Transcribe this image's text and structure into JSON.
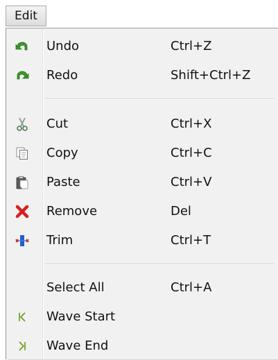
{
  "menubar": {
    "title": "Edit"
  },
  "menu": {
    "items": [
      {
        "label": "Undo",
        "shortcut": "Ctrl+Z",
        "icon": "undo-icon"
      },
      {
        "label": "Redo",
        "shortcut": "Shift+Ctrl+Z",
        "icon": "redo-icon"
      },
      {
        "label": "Cut",
        "shortcut": "Ctrl+X",
        "icon": "scissors-icon"
      },
      {
        "label": "Copy",
        "shortcut": "Ctrl+C",
        "icon": "copy-icon"
      },
      {
        "label": "Paste",
        "shortcut": "Ctrl+V",
        "icon": "paste-icon"
      },
      {
        "label": "Remove",
        "shortcut": "Del",
        "icon": "remove-x-icon"
      },
      {
        "label": "Trim",
        "shortcut": "Ctrl+T",
        "icon": "trim-icon"
      },
      {
        "label": "Select All",
        "shortcut": "Ctrl+A",
        "icon": ""
      },
      {
        "label": "Wave Start",
        "shortcut": "",
        "icon": "wave-start-icon"
      },
      {
        "label": "Wave End",
        "shortcut": "",
        "icon": "wave-end-icon"
      }
    ]
  },
  "colors": {
    "undo_redo_green": "#3a9a2a",
    "remove_red": "#d42020",
    "trim_blue": "#2060c8",
    "wave_marker_green": "#6a9a10"
  }
}
